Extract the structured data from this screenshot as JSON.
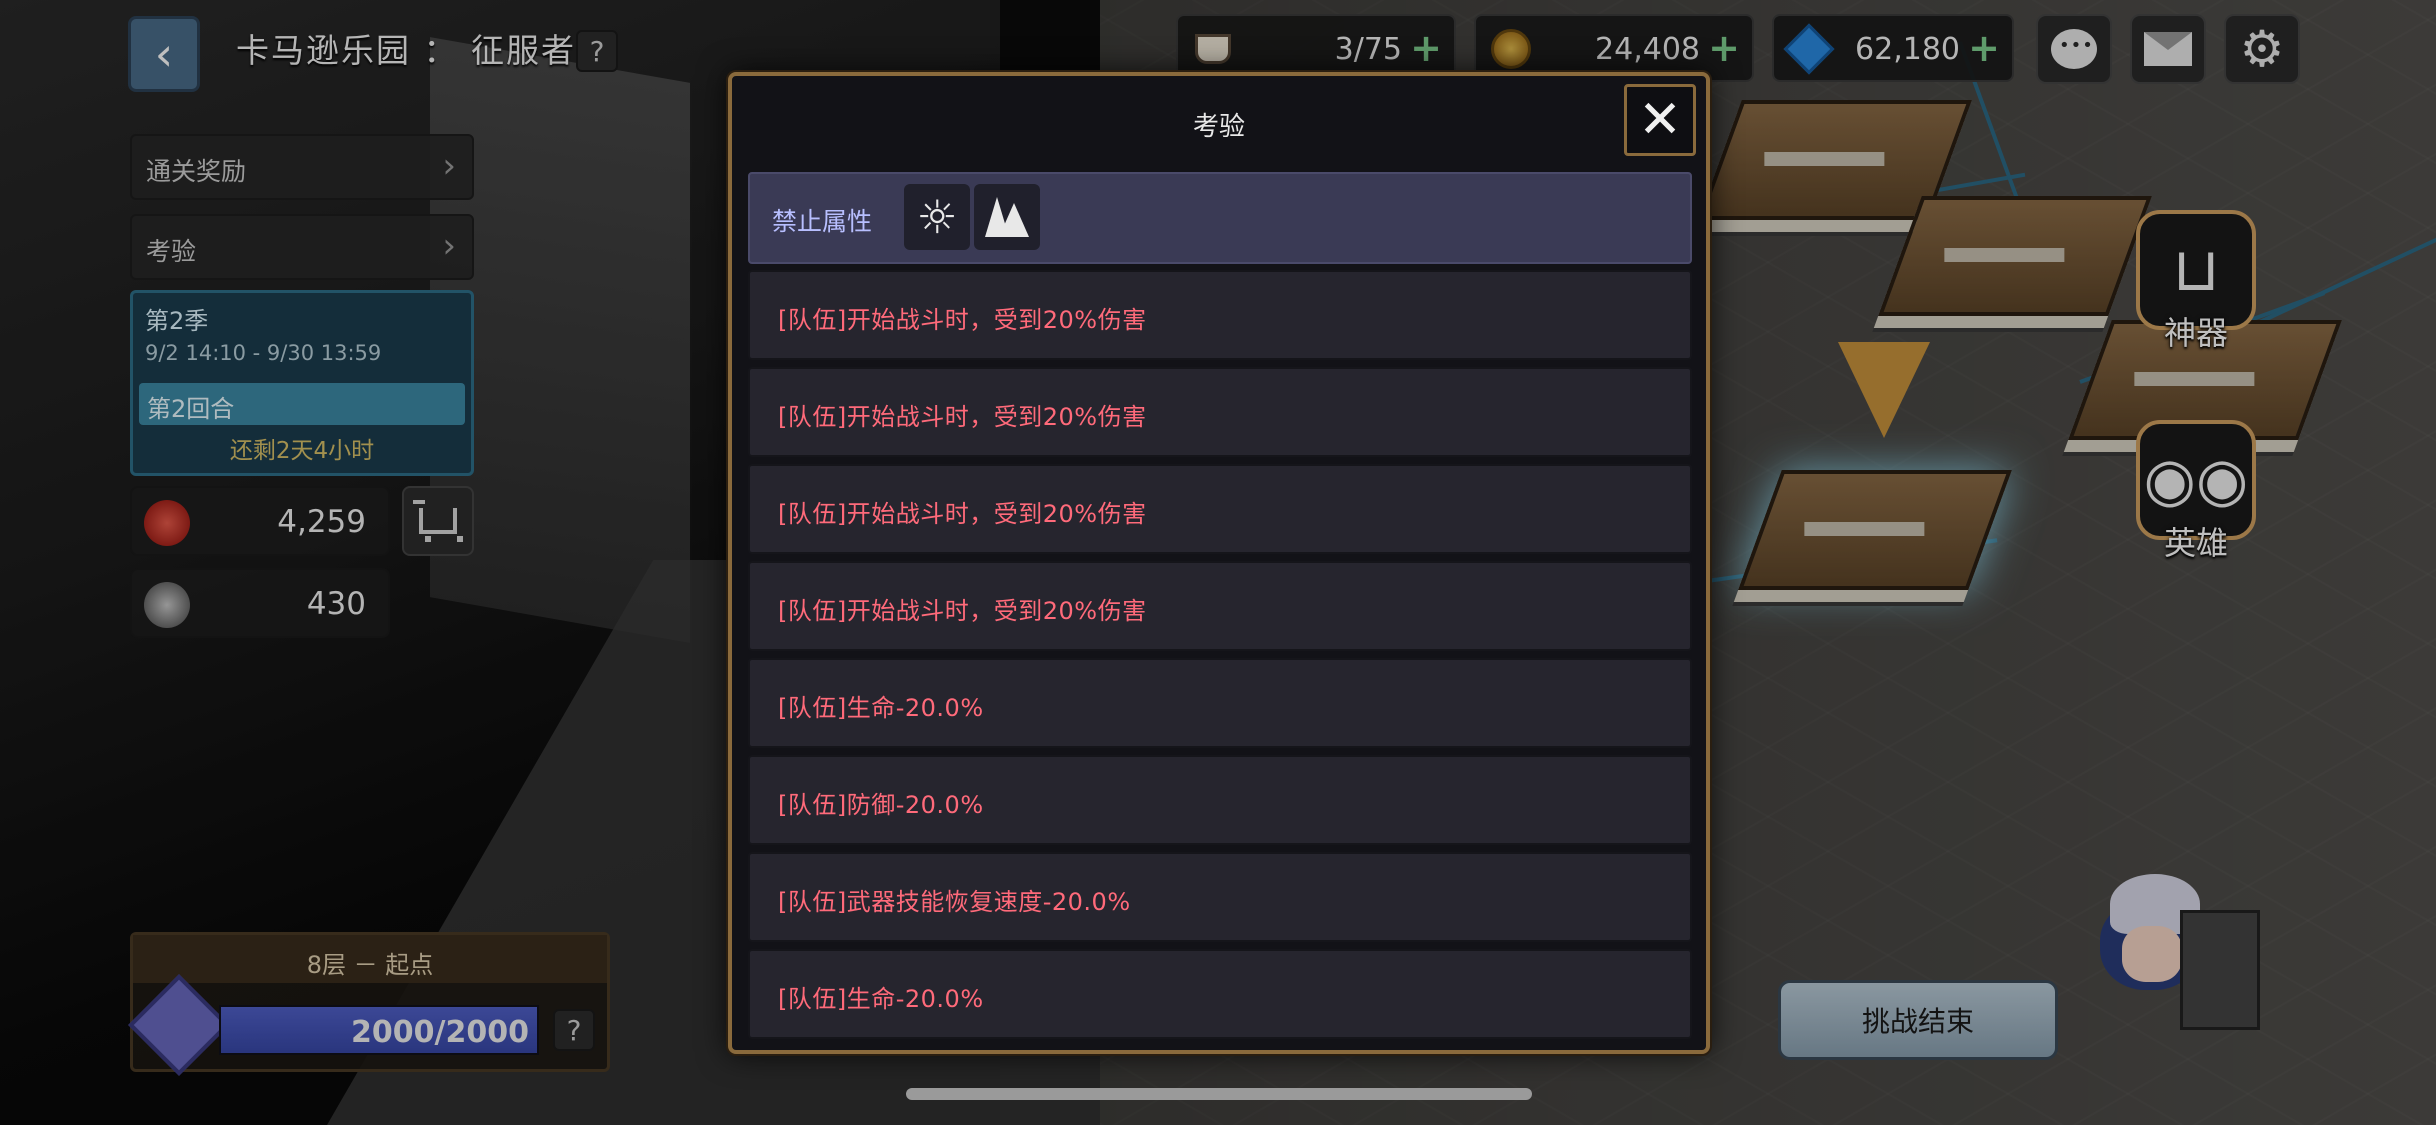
{
  "header": {
    "back_icon": "back-arrow-icon",
    "title": "卡马逊乐园 ： 征服者",
    "help_label": "?"
  },
  "resources": [
    {
      "name": "stamina",
      "icon": "coffee-cup-icon",
      "current": "3",
      "separator": "/",
      "max": "75",
      "plus": "+"
    },
    {
      "name": "gold",
      "icon": "gold-coin-icon",
      "value": "24,408",
      "plus": "+"
    },
    {
      "name": "gems",
      "icon": "diamond-icon",
      "value": "62,180",
      "plus": "+"
    }
  ],
  "top_buttons": [
    {
      "name": "chat",
      "icon": "chat-bubble-icon"
    },
    {
      "name": "mail",
      "icon": "envelope-icon"
    },
    {
      "name": "settings",
      "icon": "gear-icon",
      "glyph": "⚙"
    }
  ],
  "left_panel": {
    "clear_reward": "通关奖励",
    "trial": "考验",
    "chevron": "›",
    "season": {
      "title": "第2季",
      "range": "9/2 14:10 - 9/30 13:59",
      "round": "第2回合",
      "remaining": "还剩2天4小时"
    },
    "currency_1": {
      "icon": "red-token-icon",
      "value": "4,259",
      "color": "#c8342c"
    },
    "currency_2": {
      "icon": "silver-token-icon",
      "value": "430",
      "color": "#9a9a9a"
    },
    "shop_icon": "shopping-cart-icon"
  },
  "floor": {
    "label": "8层 － 起点",
    "hp_current": "2000",
    "hp_max": "2000",
    "hp_text": "2000/2000",
    "hp_fraction": 1.0,
    "help_label": "?"
  },
  "map": {
    "artifact_label": "神器",
    "hero_label": "英雄",
    "end_button": "挑战结束"
  },
  "modal": {
    "title": "考验",
    "close_glyph": "✕",
    "banned_label": "禁止属性",
    "banned_icons": [
      {
        "name": "light-attribute-icon",
        "glyph": "☼"
      },
      {
        "name": "earth-attribute-icon"
      }
    ],
    "effects": [
      "[队伍]开始战斗时，受到20%伤害",
      "[队伍]开始战斗时，受到20%伤害",
      "[队伍]开始战斗时，受到20%伤害",
      "[队伍]开始战斗时，受到20%伤害",
      "[队伍]生命-20.0%",
      "[队伍]防御-20.0%",
      "[队伍]武器技能恢复速度-20.0%",
      "[队伍]生命-20.0%"
    ]
  },
  "colors": {
    "accent_gold": "#8a6a3c",
    "effect_text": "#ff6a7a",
    "banned_bg": "#3a3a55",
    "season_bg": "#1b3c4e",
    "remaining_text": "#d8c068",
    "plus_green": "#7fcf8f"
  }
}
